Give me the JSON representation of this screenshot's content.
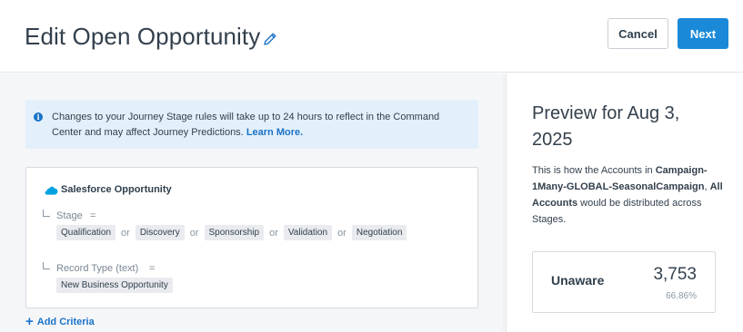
{
  "header": {
    "title": "Edit Open Opportunity",
    "cancel_label": "Cancel",
    "next_label": "Next"
  },
  "info_banner": {
    "text": "Changes to your Journey Stage rules will take up to 24 hours to reflect in the Command Center and may affect Journey Predictions.",
    "link_label": "Learn More."
  },
  "criteria": {
    "source_title": "Salesforce Opportunity",
    "fields": [
      {
        "label": "Stage",
        "operator": "=",
        "values": [
          "Qualification",
          "Discovery",
          "Sponsorship",
          "Validation",
          "Negotiation"
        ]
      },
      {
        "label": "Record Type (text)",
        "operator": "=",
        "values": [
          "New Business Opportunity"
        ]
      }
    ],
    "or_label": "or",
    "add_label": "Add Criteria"
  },
  "preview": {
    "title": "Preview for Aug 3, 2025",
    "desc_prefix": "This is how the Accounts in ",
    "campaign": "Campaign-1Many-GLOBAL-SeasonalCampaign",
    "desc_sep": ", ",
    "segment": "All Accounts",
    "desc_suffix": " would be distributed across Stages.",
    "stage": {
      "name": "Unaware",
      "count": "3,753",
      "percent": "66.86%"
    }
  },
  "colors": {
    "accent": "#1a8ad8",
    "link": "#1a73c9",
    "banner_bg": "#e3f0fb",
    "salesforce": "#00a1e0"
  }
}
